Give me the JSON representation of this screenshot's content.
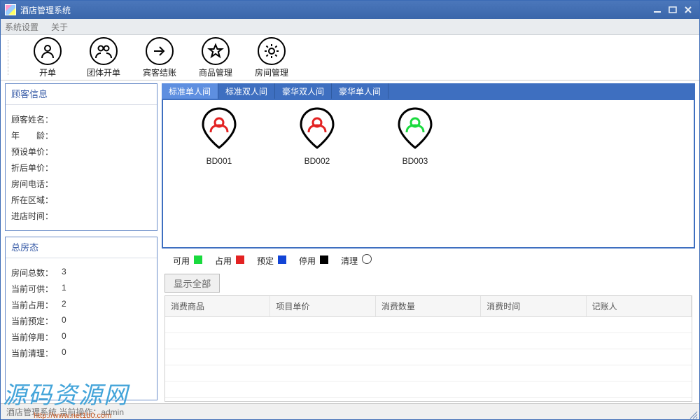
{
  "window": {
    "title": "酒店管理系统"
  },
  "menubar": {
    "items": [
      "系统设置",
      "关于"
    ]
  },
  "toolbar": {
    "buttons": [
      {
        "name": "new-order",
        "label": "开单"
      },
      {
        "name": "group-order",
        "label": "团体开单"
      },
      {
        "name": "guest-checkout",
        "label": "宾客结账"
      },
      {
        "name": "goods-manage",
        "label": "商品管理"
      },
      {
        "name": "room-manage",
        "label": "房间管理"
      }
    ]
  },
  "customer_panel": {
    "title": "顾客信息",
    "fields": [
      {
        "label": "顾客姓名：",
        "value": ""
      },
      {
        "label": "年　　龄：",
        "value": ""
      },
      {
        "label": "预设单价：",
        "value": ""
      },
      {
        "label": "折后单价：",
        "value": ""
      },
      {
        "label": "房间电话：",
        "value": ""
      },
      {
        "label": "所在区域：",
        "value": ""
      },
      {
        "label": "进店时间：",
        "value": ""
      }
    ]
  },
  "status_panel": {
    "title": "总房态",
    "fields": [
      {
        "label": "房间总数：",
        "value": "3"
      },
      {
        "label": "当前可供：",
        "value": "1"
      },
      {
        "label": "当前占用：",
        "value": "2"
      },
      {
        "label": "当前预定：",
        "value": "0"
      },
      {
        "label": "当前停用：",
        "value": "0"
      },
      {
        "label": "当前清理：",
        "value": "0"
      }
    ]
  },
  "tabs": {
    "items": [
      "标准单人间",
      "标准双人间",
      "豪华双人间",
      "豪华单人间"
    ],
    "active_index": 0
  },
  "rooms": [
    {
      "code": "BD001",
      "state": "occupied"
    },
    {
      "code": "BD002",
      "state": "occupied"
    },
    {
      "code": "BD003",
      "state": "available"
    }
  ],
  "legend": {
    "available": "可用",
    "occupied": "占用",
    "reserved": "预定",
    "disabled": "停用",
    "cleaning": "清理"
  },
  "show_all_btn": "显示全部",
  "table": {
    "columns": [
      "消费商品",
      "项目单价",
      "消费数量",
      "消费时间",
      "记账人"
    ],
    "rows": []
  },
  "statusbar": {
    "text": "酒店管理系统  当前操作：admin"
  },
  "watermark": {
    "text": "源码资源网",
    "url": "http://www.net1b0.com"
  }
}
